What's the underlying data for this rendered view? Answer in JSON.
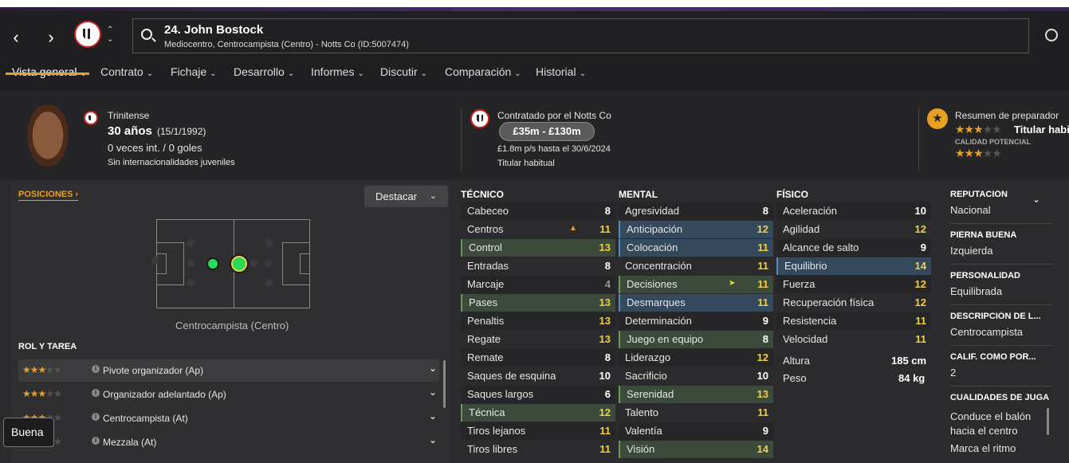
{
  "header": {
    "player_name": "24. John Bostock",
    "player_sub": "Mediocentro, Centrocampista (Centro) - Notts Co (ID:5007474)"
  },
  "tabs": [
    {
      "label": "Vista general"
    },
    {
      "label": "Contrato"
    },
    {
      "label": "Fichaje"
    },
    {
      "label": "Desarrollo"
    },
    {
      "label": "Informes"
    },
    {
      "label": "Discutir"
    },
    {
      "label": "Comparación"
    },
    {
      "label": "Historial"
    }
  ],
  "profile": {
    "nationality": "Trinitense",
    "age": "30 años",
    "dob": "(15/1/1992)",
    "caps": "0 veces int. / 0 goles",
    "youth": "Sin internacionalidades juveniles"
  },
  "contract": {
    "title": "Contratado por el Notts Co",
    "value_range": "£35m - £130m",
    "wage": "£1.8m p/s hasta el 30/6/2024",
    "status": "Titular habitual"
  },
  "coach": {
    "title": "Resumen de preparador",
    "verdict": "Titular habi",
    "potential_label": "CALIDAD POTENCIAL",
    "current_stars": 3,
    "potential_stars": 3
  },
  "positions": {
    "title": "POSICIONES",
    "highlight_button": "Destacar",
    "position_label": "Centrocampista (Centro)"
  },
  "roles": {
    "title": "ROL Y TAREA",
    "items": [
      {
        "label": "Pivote organizador (Ap)",
        "stars": 3
      },
      {
        "label": "Organizador adelantado (Ap)",
        "stars": 3
      },
      {
        "label": "Centrocampista (At)",
        "stars": 3
      },
      {
        "label": "Mezzala (At)",
        "stars": 3
      }
    ],
    "tooltip": "Buena"
  },
  "technical": {
    "title": "TÉCNICO",
    "items": [
      {
        "name": "Cabeceo",
        "value": "8"
      },
      {
        "name": "Centros",
        "value": "11"
      },
      {
        "name": "Control",
        "value": "13"
      },
      {
        "name": "Entradas",
        "value": "8"
      },
      {
        "name": "Marcaje",
        "value": "4"
      },
      {
        "name": "Pases",
        "value": "13"
      },
      {
        "name": "Penaltis",
        "value": "13"
      },
      {
        "name": "Regate",
        "value": "13"
      },
      {
        "name": "Remate",
        "value": "8"
      },
      {
        "name": "Saques de esquina",
        "value": "10"
      },
      {
        "name": "Saques largos",
        "value": "6"
      },
      {
        "name": "Técnica",
        "value": "12"
      },
      {
        "name": "Tiros lejanos",
        "value": "11"
      },
      {
        "name": "Tiros libres",
        "value": "11"
      }
    ]
  },
  "mental": {
    "title": "MENTAL",
    "items": [
      {
        "name": "Agresividad",
        "value": "8"
      },
      {
        "name": "Anticipación",
        "value": "12"
      },
      {
        "name": "Colocación",
        "value": "11"
      },
      {
        "name": "Concentración",
        "value": "11"
      },
      {
        "name": "Decisiones",
        "value": "11"
      },
      {
        "name": "Desmarques",
        "value": "11"
      },
      {
        "name": "Determinación",
        "value": "9"
      },
      {
        "name": "Juego en equipo",
        "value": "8"
      },
      {
        "name": "Liderazgo",
        "value": "12"
      },
      {
        "name": "Sacrificio",
        "value": "10"
      },
      {
        "name": "Serenidad",
        "value": "13"
      },
      {
        "name": "Talento",
        "value": "11"
      },
      {
        "name": "Valentía",
        "value": "9"
      },
      {
        "name": "Visión",
        "value": "14"
      }
    ]
  },
  "physical": {
    "title": "FÍSICO",
    "items": [
      {
        "name": "Aceleración",
        "value": "10"
      },
      {
        "name": "Agilidad",
        "value": "12"
      },
      {
        "name": "Alcance de salto",
        "value": "9"
      },
      {
        "name": "Equilibrio",
        "value": "14"
      },
      {
        "name": "Fuerza",
        "value": "12"
      },
      {
        "name": "Recuperación física",
        "value": "12"
      },
      {
        "name": "Resistencia",
        "value": "11"
      },
      {
        "name": "Velocidad",
        "value": "11"
      }
    ],
    "height_label": "Altura",
    "height_value": "185 cm",
    "weight_label": "Peso",
    "weight_value": "84 kg"
  },
  "side": {
    "reputation_label": "REPUTACIÓN",
    "reputation_value": "Nacional",
    "foot_label": "PIERNA BUENA",
    "foot_value": "Izquierda",
    "personality_label": "PERSONALIDAD",
    "personality_value": "Equilibrada",
    "desc_label": "DESCRIPCIÓN DE L...",
    "desc_value": "Centrocampista",
    "rating_label": "CALIF. COMO POR...",
    "rating_value": "2",
    "qualities_label": "CUALIDADES DE JUGA",
    "qualities": [
      "Conduce el balón",
      "hacia el centro",
      "Marca el ritmo"
    ]
  },
  "colors": {
    "accent": "#e8a020",
    "highlight_yellow": "#f0d040"
  }
}
